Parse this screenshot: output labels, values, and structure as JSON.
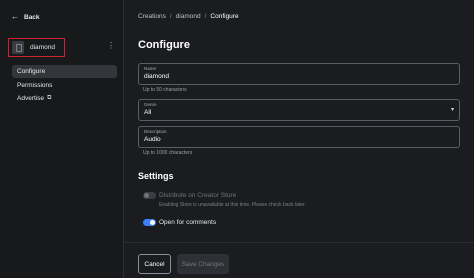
{
  "sidebar": {
    "back_label": "Back",
    "item": {
      "name": "diamond"
    },
    "nav": [
      {
        "label": "Configure"
      },
      {
        "label": "Permissions"
      },
      {
        "label": "Advertise"
      }
    ]
  },
  "breadcrumb": [
    "Creations",
    "diamond",
    "Configure"
  ],
  "page_title": "Configure",
  "form": {
    "name": {
      "label": "Name",
      "value": "diamond",
      "hint": "Up to 50 characters"
    },
    "genre": {
      "label": "Genre",
      "value": "All"
    },
    "description": {
      "label": "Description",
      "value": "Audio",
      "hint": "Up to 1000 characters"
    }
  },
  "settings": {
    "title": "Settings",
    "distribute": {
      "label": "Distribute on Creator Store",
      "enabled": false,
      "hint": "Enabling Store is unavailable at this time. Please check back later."
    },
    "comments": {
      "label": "Open for comments",
      "enabled": true
    }
  },
  "buttons": {
    "cancel": "Cancel",
    "save": "Save Changes"
  },
  "colors": {
    "accent": "#3b82f6",
    "highlight_border": "#d0222a"
  },
  "icons": {
    "back": "arrow-left-icon",
    "kebab": "more-vertical-icon",
    "external": "external-link-icon",
    "select": "chevron-down-icon"
  }
}
